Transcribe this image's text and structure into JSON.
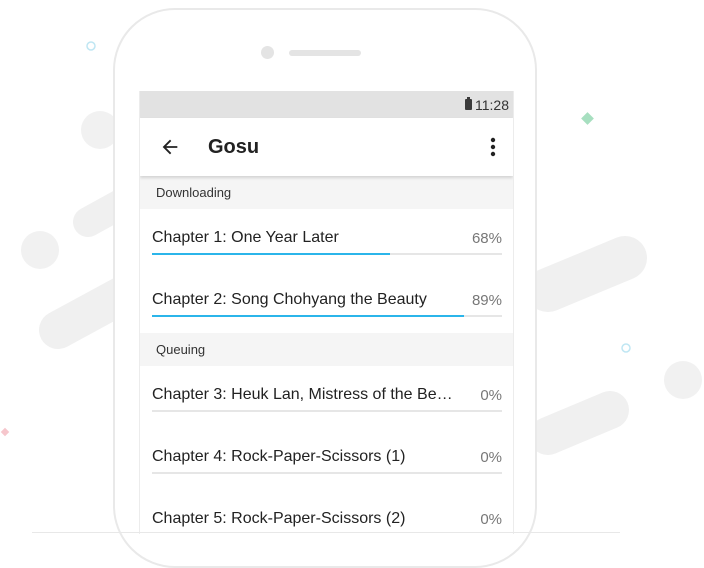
{
  "status_bar": {
    "time": "11:28"
  },
  "app_bar": {
    "title": "Gosu",
    "back_icon": "arrow-left-icon",
    "menu_icon": "more-vert-icon"
  },
  "sections": {
    "downloading": {
      "label": "Downloading",
      "items": [
        {
          "title": "Chapter 1: One Year Later",
          "percent_text": "68%",
          "progress": 0.68
        },
        {
          "title": "Chapter 2: Song Chohyang the Beauty",
          "percent_text": "89%",
          "progress": 0.89
        }
      ]
    },
    "queuing": {
      "label": "Queuing",
      "items": [
        {
          "title": "Chapter 3: Heuk Lan, Mistress of the Be…",
          "percent_text": "0%",
          "progress": 0
        },
        {
          "title": "Chapter 4: Rock-Paper-Scissors (1)",
          "percent_text": "0%",
          "progress": 0
        },
        {
          "title": "Chapter 5: Rock-Paper-Scissors (2)",
          "percent_text": "0%",
          "progress": 0
        }
      ]
    }
  },
  "colors": {
    "accent": "#2bb5ea",
    "track": "#e6e6e6",
    "status_bar": "#e2e2e2"
  }
}
